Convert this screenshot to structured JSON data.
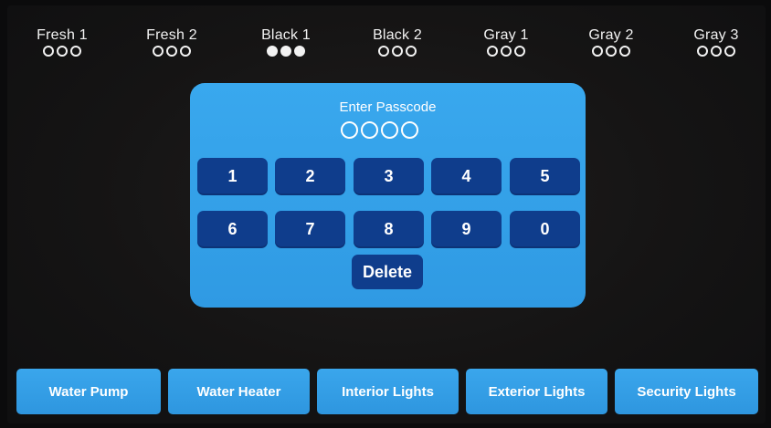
{
  "tanks": [
    {
      "label": "Fresh 1",
      "level": "0 of 3"
    },
    {
      "label": "Fresh 2",
      "level": "0 of 3"
    },
    {
      "label": "Black 1",
      "level": "3 of 3"
    },
    {
      "label": "Black 2",
      "level": "0 of 3"
    },
    {
      "label": "Gray 1",
      "level": "0 of 3"
    },
    {
      "label": "Gray 2",
      "level": "0 of 3"
    },
    {
      "label": "Gray 3",
      "level": "0 of 3"
    }
  ],
  "passcode": {
    "title": "Enter Passcode",
    "entered_digits": 0,
    "total_digits": 4,
    "keys": [
      "1",
      "2",
      "3",
      "4",
      "5",
      "6",
      "7",
      "8",
      "9",
      "0"
    ],
    "delete_label": "Delete"
  },
  "bottom_buttons": [
    {
      "label": "Water Pump"
    },
    {
      "label": "Water Heater"
    },
    {
      "label": "Interior Lights"
    },
    {
      "label": "Exterior Lights"
    },
    {
      "label": "Security Lights"
    }
  ],
  "colors": {
    "panel": "#39a8ee",
    "key": "#0f3d8c",
    "button": "#3aa6ec",
    "background": "#151414",
    "text": "#ffffff"
  }
}
